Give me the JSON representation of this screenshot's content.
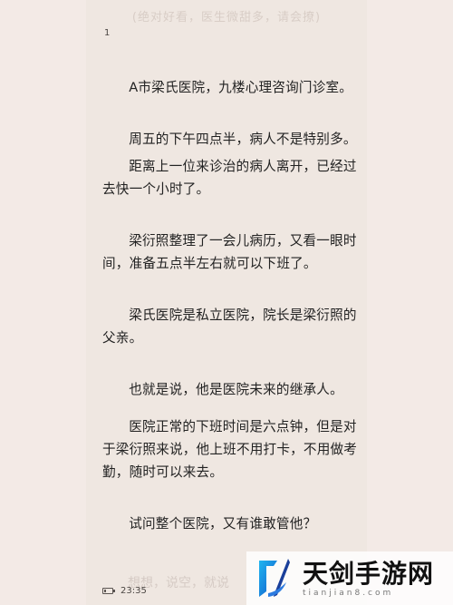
{
  "reader": {
    "header_text": "(绝对好看，医生微甜多，请会撩)",
    "page_number": "1",
    "paragraphs": [
      "A市梁氏医院，九楼心理咨询门诊室。",
      "周五的下午四点半，病人不是特别多。",
      "距离上一位来诊治的病人离开，已经过去快一个小时了。",
      "梁衍照整理了一会儿病历，又看一眼时间，准备五点半左右就可以下班了。",
      "梁氏医院是私立医院，院长是梁衍照的父亲。",
      "也就是说，他是医院未来的继承人。",
      "医院正常的下班时间是六点钟，但是对于梁衍照来说，他上班不用打卡，不用做考勤，随时可以来去。",
      "试问整个医院，又有谁敢管他？"
    ],
    "faded_line": "想想，说空，就说"
  },
  "status_bar": {
    "time": "23:35",
    "battery_level": 0.2
  },
  "watermark": {
    "title": "天剑手游网",
    "domain": "tianjian8.com",
    "logo_icon": "blue-sword-logo"
  },
  "colors": {
    "background": "#f3eae6",
    "page": "#efe7e1",
    "text": "#222222"
  }
}
